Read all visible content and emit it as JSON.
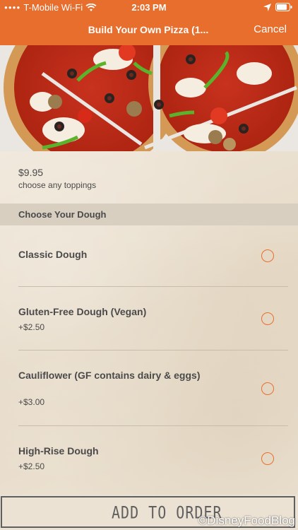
{
  "status_bar": {
    "carrier": "T-Mobile Wi-Fi",
    "time": "2:03 PM"
  },
  "nav": {
    "title": "Build Your Own Pizza (1...",
    "cancel_label": "Cancel"
  },
  "item": {
    "price": "$9.95",
    "description": "choose any toppings"
  },
  "dough_section": {
    "header": "Choose Your Dough",
    "options": [
      {
        "name": "Classic Dough",
        "extra": ""
      },
      {
        "name": "Gluten-Free Dough (Vegan)",
        "extra": "+$2.50"
      },
      {
        "name": "Cauliflower (GF contains dairy & eggs)",
        "extra": "+$3.00"
      },
      {
        "name": "High-Rise Dough",
        "extra": "+$2.50"
      }
    ]
  },
  "order_button": {
    "label": "ADD TO ORDER"
  },
  "watermark": "©DisneyFoodBlog",
  "colors": {
    "accent": "#e86e2d",
    "text": "#4a4a4a",
    "background": "#ece2d3"
  }
}
